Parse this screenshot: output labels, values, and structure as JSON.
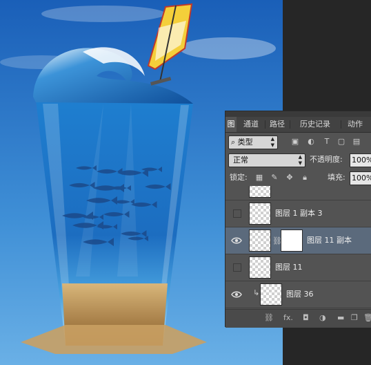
{
  "panel": {
    "tabs": [
      {
        "label": "通道"
      },
      {
        "label": "路径"
      },
      {
        "label": "历史记录"
      },
      {
        "label": "动作"
      }
    ],
    "filter_kind": "类型",
    "blend_mode": "正常",
    "opacity_label": "不透明度:",
    "opacity_value": "100%",
    "lock_label": "锁定:",
    "fill_label": "填充:",
    "fill_value": "100%",
    "layers": [
      {
        "name": "图层 1 副本 3",
        "visible": false,
        "selected": false
      },
      {
        "name": "图层 11 副本",
        "visible": true,
        "selected": true
      },
      {
        "name": "图层 11",
        "visible": false,
        "selected": false
      },
      {
        "name": "图层 36",
        "visible": true,
        "selected": false
      }
    ]
  },
  "colors": {
    "sky_top": "#1a5fb8",
    "sky_bottom": "#6ab0e6",
    "water": "#2b8fd6",
    "sand": "#b88a4a",
    "panel_bg": "#535353",
    "selected_row": "#5b6a7c"
  }
}
